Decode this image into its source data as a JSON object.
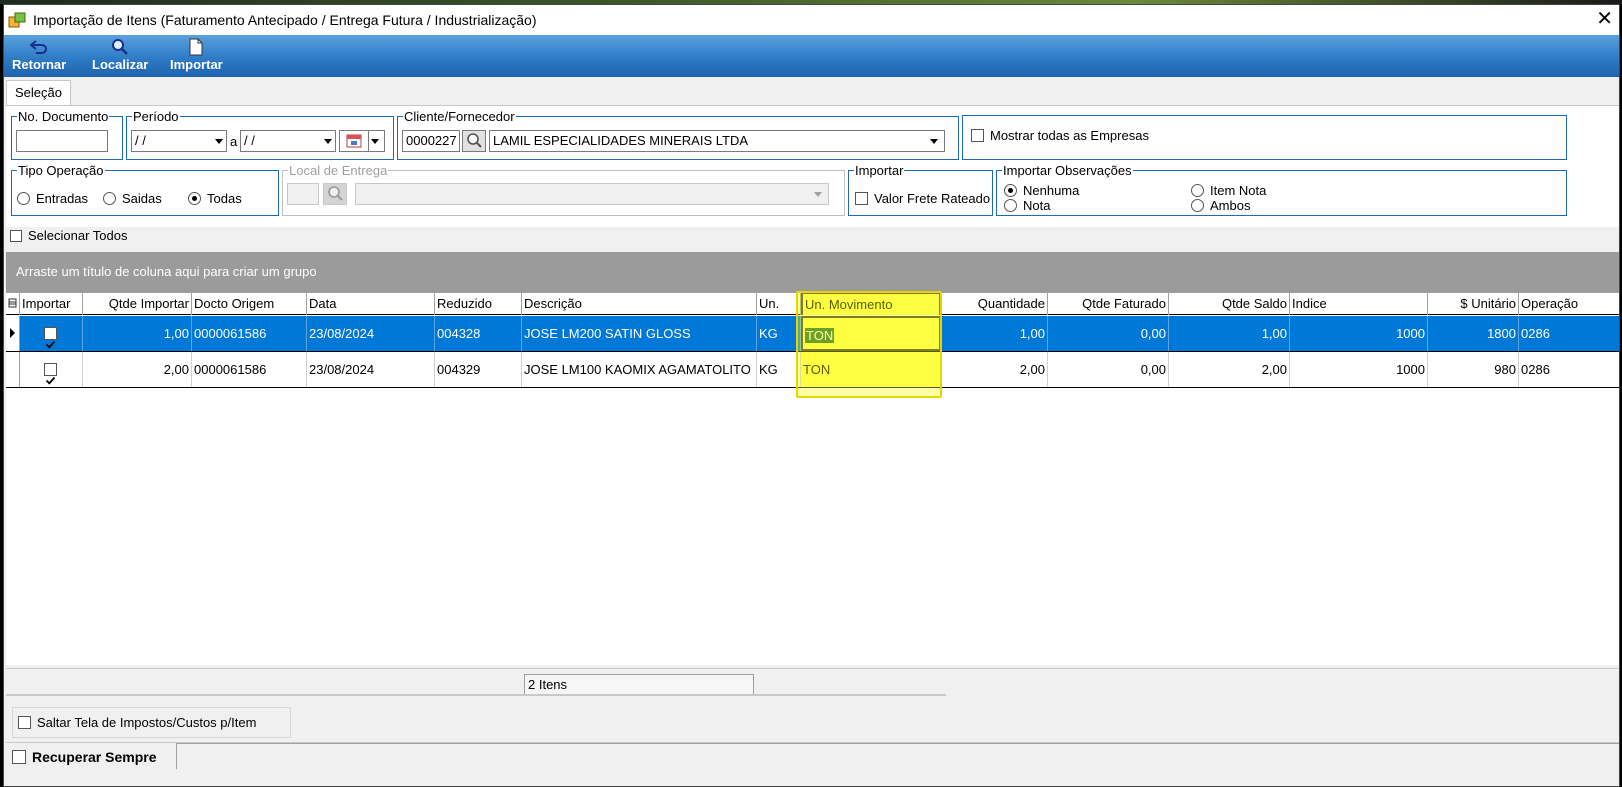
{
  "window": {
    "title": "Importação de Itens (Faturamento Antecipado / Entrega Futura / Industrialização)",
    "close_glyph": "✕"
  },
  "toolbar": {
    "retornar": "Retornar",
    "localizar": "Localizar",
    "importar": "Importar"
  },
  "tabs": [
    "Seleção"
  ],
  "filters": {
    "no_documento": {
      "label": "No. Documento",
      "value": ""
    },
    "periodo": {
      "label": "Período",
      "from": " / /",
      "sep": "a",
      "to": " / /"
    },
    "cliente": {
      "label": "Cliente/Fornecedor",
      "code": "0000227",
      "name": "LAMIL ESPECIALIDADES MINERAIS LTDA"
    },
    "mostrar_todas": "Mostrar todas as Empresas",
    "tipo_operacao": {
      "label": "Tipo Operação",
      "options": [
        "Entradas",
        "Saidas",
        "Todas"
      ],
      "selected": "Todas"
    },
    "local_entrega": {
      "label": "Local de Entrega"
    },
    "importar": {
      "label": "Importar",
      "valor_frete": "Valor Frete Rateado"
    },
    "importar_obs": {
      "label": "Importar Observações",
      "options": [
        "Nenhuma",
        "Nota",
        "Item Nota",
        "Ambos"
      ],
      "selected": "Nenhuma"
    }
  },
  "selecionar_todos": "Selecionar Todos",
  "group_hint": "Arraste um título de coluna aqui para criar um grupo",
  "grid": {
    "columns": [
      "Importar",
      "Qtde Importar",
      "Docto Origem",
      "Data",
      "Reduzido",
      "Descrição",
      "Un.",
      "Un. Movimento",
      "Quantidade",
      "Qtde Faturado",
      "Qtde Saldo",
      "Indice",
      "$ Unitário",
      "Operação"
    ],
    "rows": [
      {
        "importar": true,
        "qtde_importar": "1,00",
        "docto": "0000061586",
        "data": "23/08/2024",
        "reduzido": "004328",
        "descricao": "JOSE LM200 SATIN GLOSS",
        "un": "KG",
        "un_mov": "TON",
        "quantidade": "1,00",
        "faturado": "0,00",
        "saldo": "1,00",
        "indice": "1000",
        "unitario": "1800",
        "operacao": "0286"
      },
      {
        "importar": true,
        "qtde_importar": "2,00",
        "docto": "0000061586",
        "data": "23/08/2024",
        "reduzido": "004329",
        "descricao": "JOSE LM100 KAOMIX AGAMATOLITO",
        "un": "KG",
        "un_mov": "TON",
        "quantidade": "2,00",
        "faturado": "0,00",
        "saldo": "2,00",
        "indice": "1000",
        "unitario": "980",
        "operacao": "0286"
      }
    ]
  },
  "footer": {
    "count": "2 Itens",
    "saltar": "Saltar Tela de Impostos/Custos p/Item",
    "recuperar": "Recuperar Sempre"
  },
  "colors": {
    "accent": "#0078d7",
    "toolbar": "#2e7cc6",
    "highlight": "#ffff00"
  }
}
